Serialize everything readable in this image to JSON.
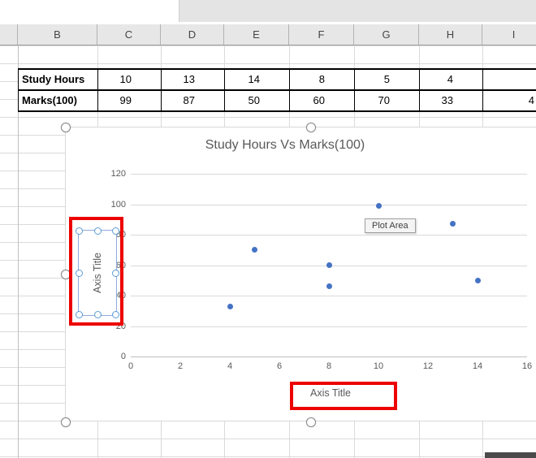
{
  "column_headers": [
    "B",
    "C",
    "D",
    "E",
    "F",
    "G",
    "H",
    "I"
  ],
  "table": {
    "rows": [
      {
        "label": "Study Hours",
        "values": [
          "10",
          "13",
          "14",
          "8",
          "5",
          "4",
          ""
        ]
      },
      {
        "label": "Marks(100)",
        "values": [
          "99",
          "87",
          "50",
          "60",
          "70",
          "33",
          "4"
        ]
      }
    ]
  },
  "chart_data": {
    "type": "scatter",
    "title": "Study Hours Vs Marks(100)",
    "x_axis_title": "Axis Title",
    "y_axis_title": "Axis Title",
    "xlim": [
      0,
      16
    ],
    "ylim": [
      0,
      120
    ],
    "x_ticks": [
      0,
      2,
      4,
      6,
      8,
      10,
      12,
      14,
      16
    ],
    "y_ticks": [
      0,
      20,
      40,
      60,
      80,
      100,
      120
    ],
    "points": [
      [
        10,
        99
      ],
      [
        13,
        87
      ],
      [
        14,
        50
      ],
      [
        8,
        60
      ],
      [
        5,
        70
      ],
      [
        4,
        33
      ],
      [
        8,
        46
      ]
    ],
    "marker_color": "#4472C4",
    "grid": true,
    "legend": "none",
    "tooltip_label": "Plot Area"
  },
  "annotations": {
    "highlight_color": "#EC0000"
  }
}
